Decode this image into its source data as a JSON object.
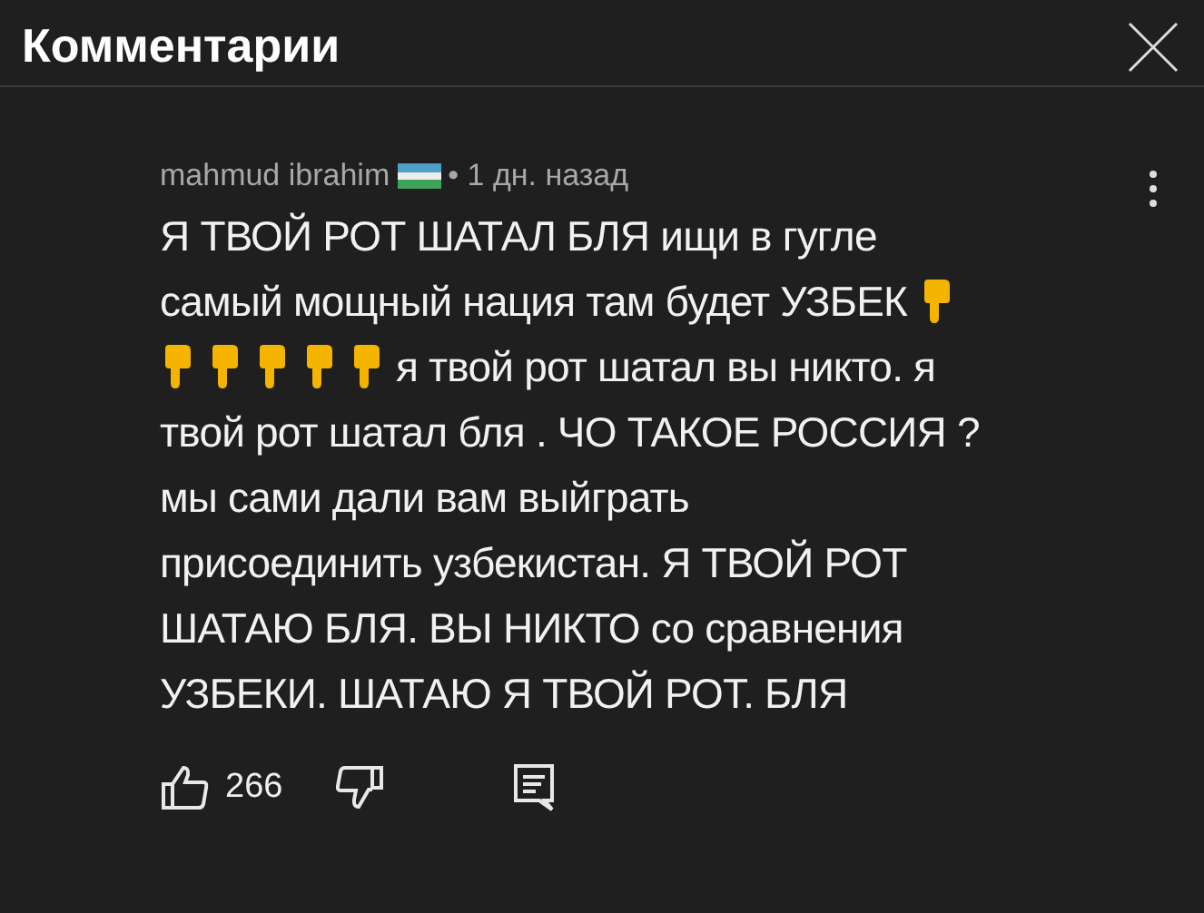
{
  "header": {
    "title": "Комментарии"
  },
  "comment": {
    "author": "mahmud ibrahim",
    "time": "• 1 дн. назад",
    "lines": [
      [
        {
          "kind": "text",
          "text": "Я ТВОЙ РОТ ШАТАЛ БЛЯ ищи в гугле"
        }
      ],
      [
        {
          "kind": "text",
          "text": "самый мощный нация там будет УЗБЕК"
        },
        {
          "kind": "hand"
        }
      ],
      [
        {
          "kind": "hand"
        },
        {
          "kind": "hand"
        },
        {
          "kind": "hand"
        },
        {
          "kind": "hand"
        },
        {
          "kind": "hand"
        },
        {
          "kind": "text",
          "text": "я твой рот шатал вы никто. я"
        }
      ],
      [
        {
          "kind": "text",
          "text": "твой рот шатал бля . ЧО ТАКОЕ РОССИЯ ?"
        }
      ],
      [
        {
          "kind": "text",
          "text": "мы сами дали вам выйграть"
        }
      ],
      [
        {
          "kind": "text",
          "text": "присоединить узбекистан. Я ТВОЙ РОТ"
        }
      ],
      [
        {
          "kind": "text",
          "text": "ШАТАЮ БЛЯ. ВЫ НИКТО со сравнения"
        }
      ],
      [
        {
          "kind": "text",
          "text": "УЗБЕКИ. ШАТАЮ Я ТВОЙ РОТ. БЛЯ"
        }
      ]
    ],
    "likes": "266"
  }
}
